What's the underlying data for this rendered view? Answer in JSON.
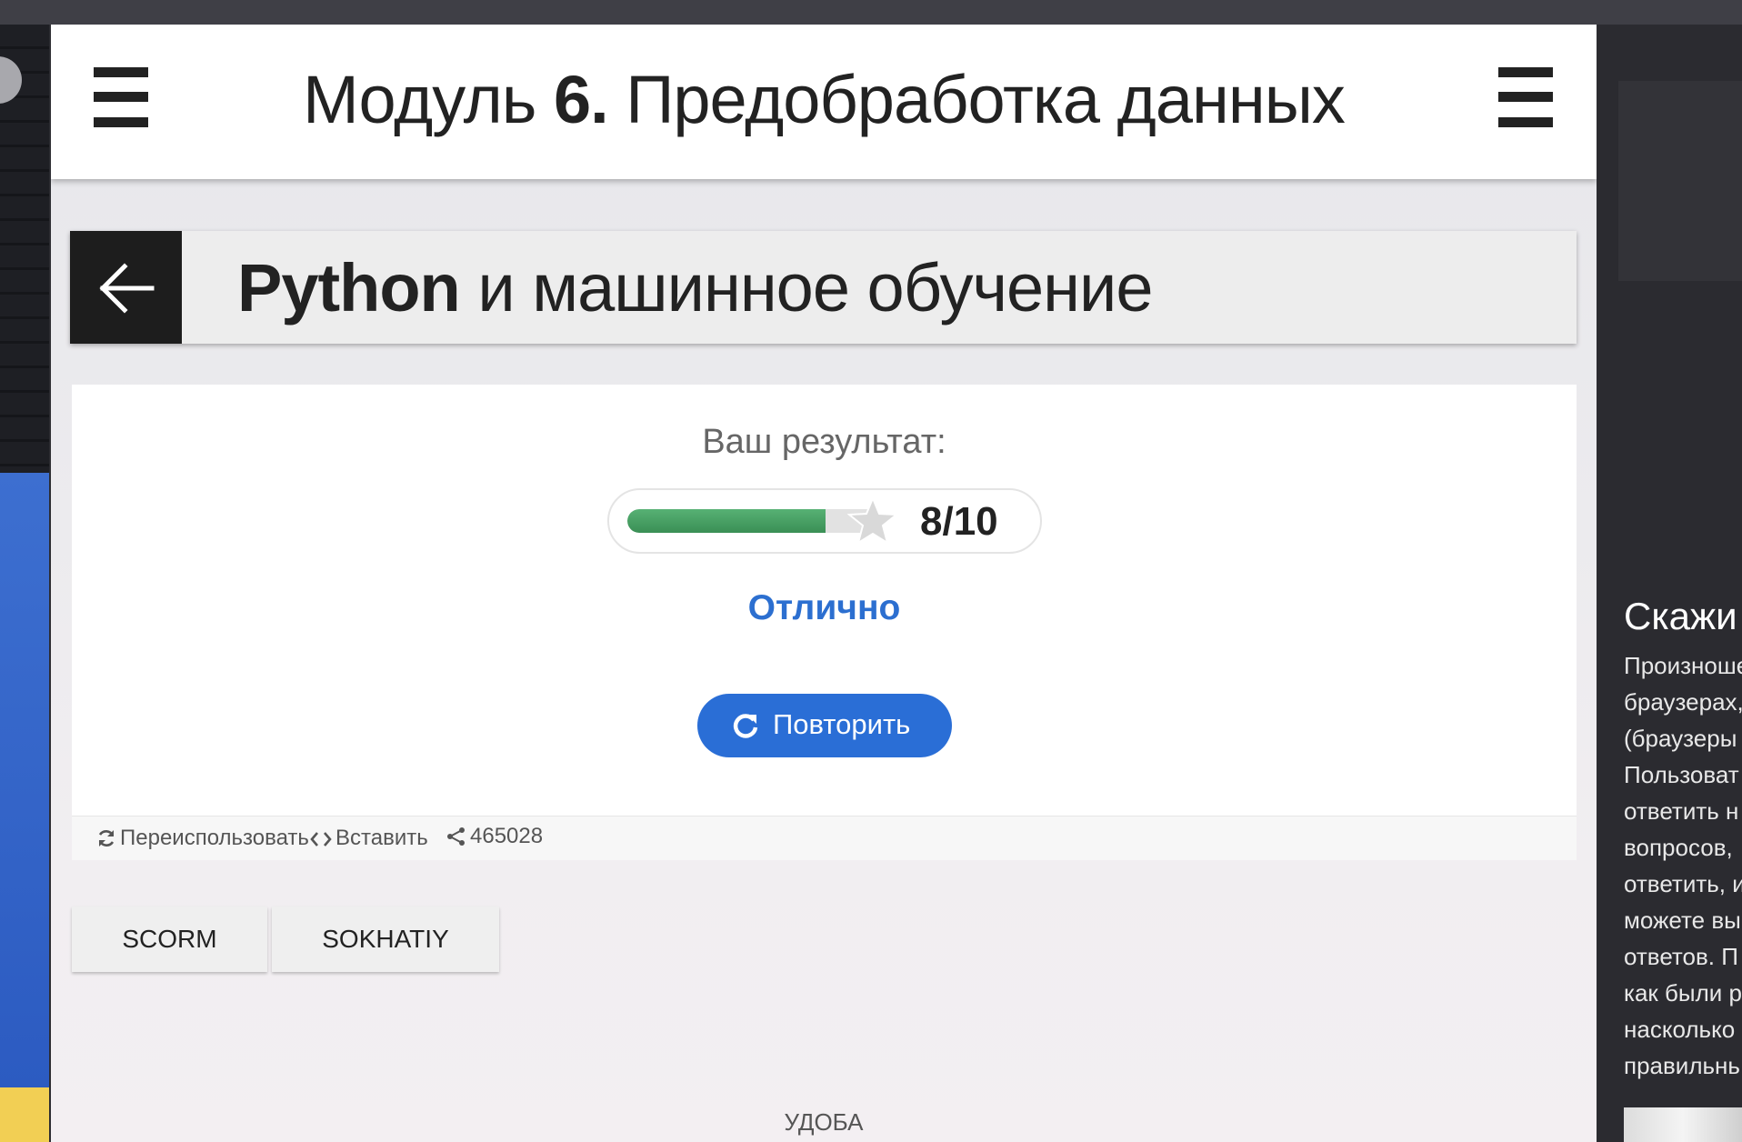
{
  "header": {
    "title_prefix": "Модуль ",
    "title_number": "6.",
    "title_suffix": " Предобработка данных"
  },
  "quiz": {
    "title_bold": "Python",
    "title_rest": " и машинное обучение",
    "result_label": "Ваш результат:",
    "score": {
      "text": "8/10",
      "correct": 8,
      "total": 10,
      "fill_fraction": 0.8
    },
    "feedback": "Отлично",
    "retry_label": "Повторить"
  },
  "footer": {
    "reuse_label": "Переиспользовать",
    "embed_label": "Вставить",
    "share_count": "465028"
  },
  "buttons": {
    "scorm": "SCORM",
    "sokhatiy": "SOKHATIY"
  },
  "brand": "УДОБА",
  "sidebar_right": {
    "heading": "Скажи",
    "lines": [
      "Произноше",
      "браузерах,",
      "(браузеры",
      "Пользоват",
      "ответить н",
      "вопросов,",
      "ответить, и",
      "можете вы",
      "ответов. П",
      "как были р",
      "насколько",
      "правильнь"
    ]
  },
  "colors": {
    "accent": "#2a6ed6",
    "feedback": "#2c6fd0",
    "progress": "#4aa165",
    "header_bg": "#ffffff",
    "back_button": "#1d1d1d"
  },
  "icons": [
    "menu-icon",
    "arrow-left-icon",
    "star-icon",
    "refresh-icon",
    "recycle-icon",
    "code-icon",
    "share-icon"
  ]
}
